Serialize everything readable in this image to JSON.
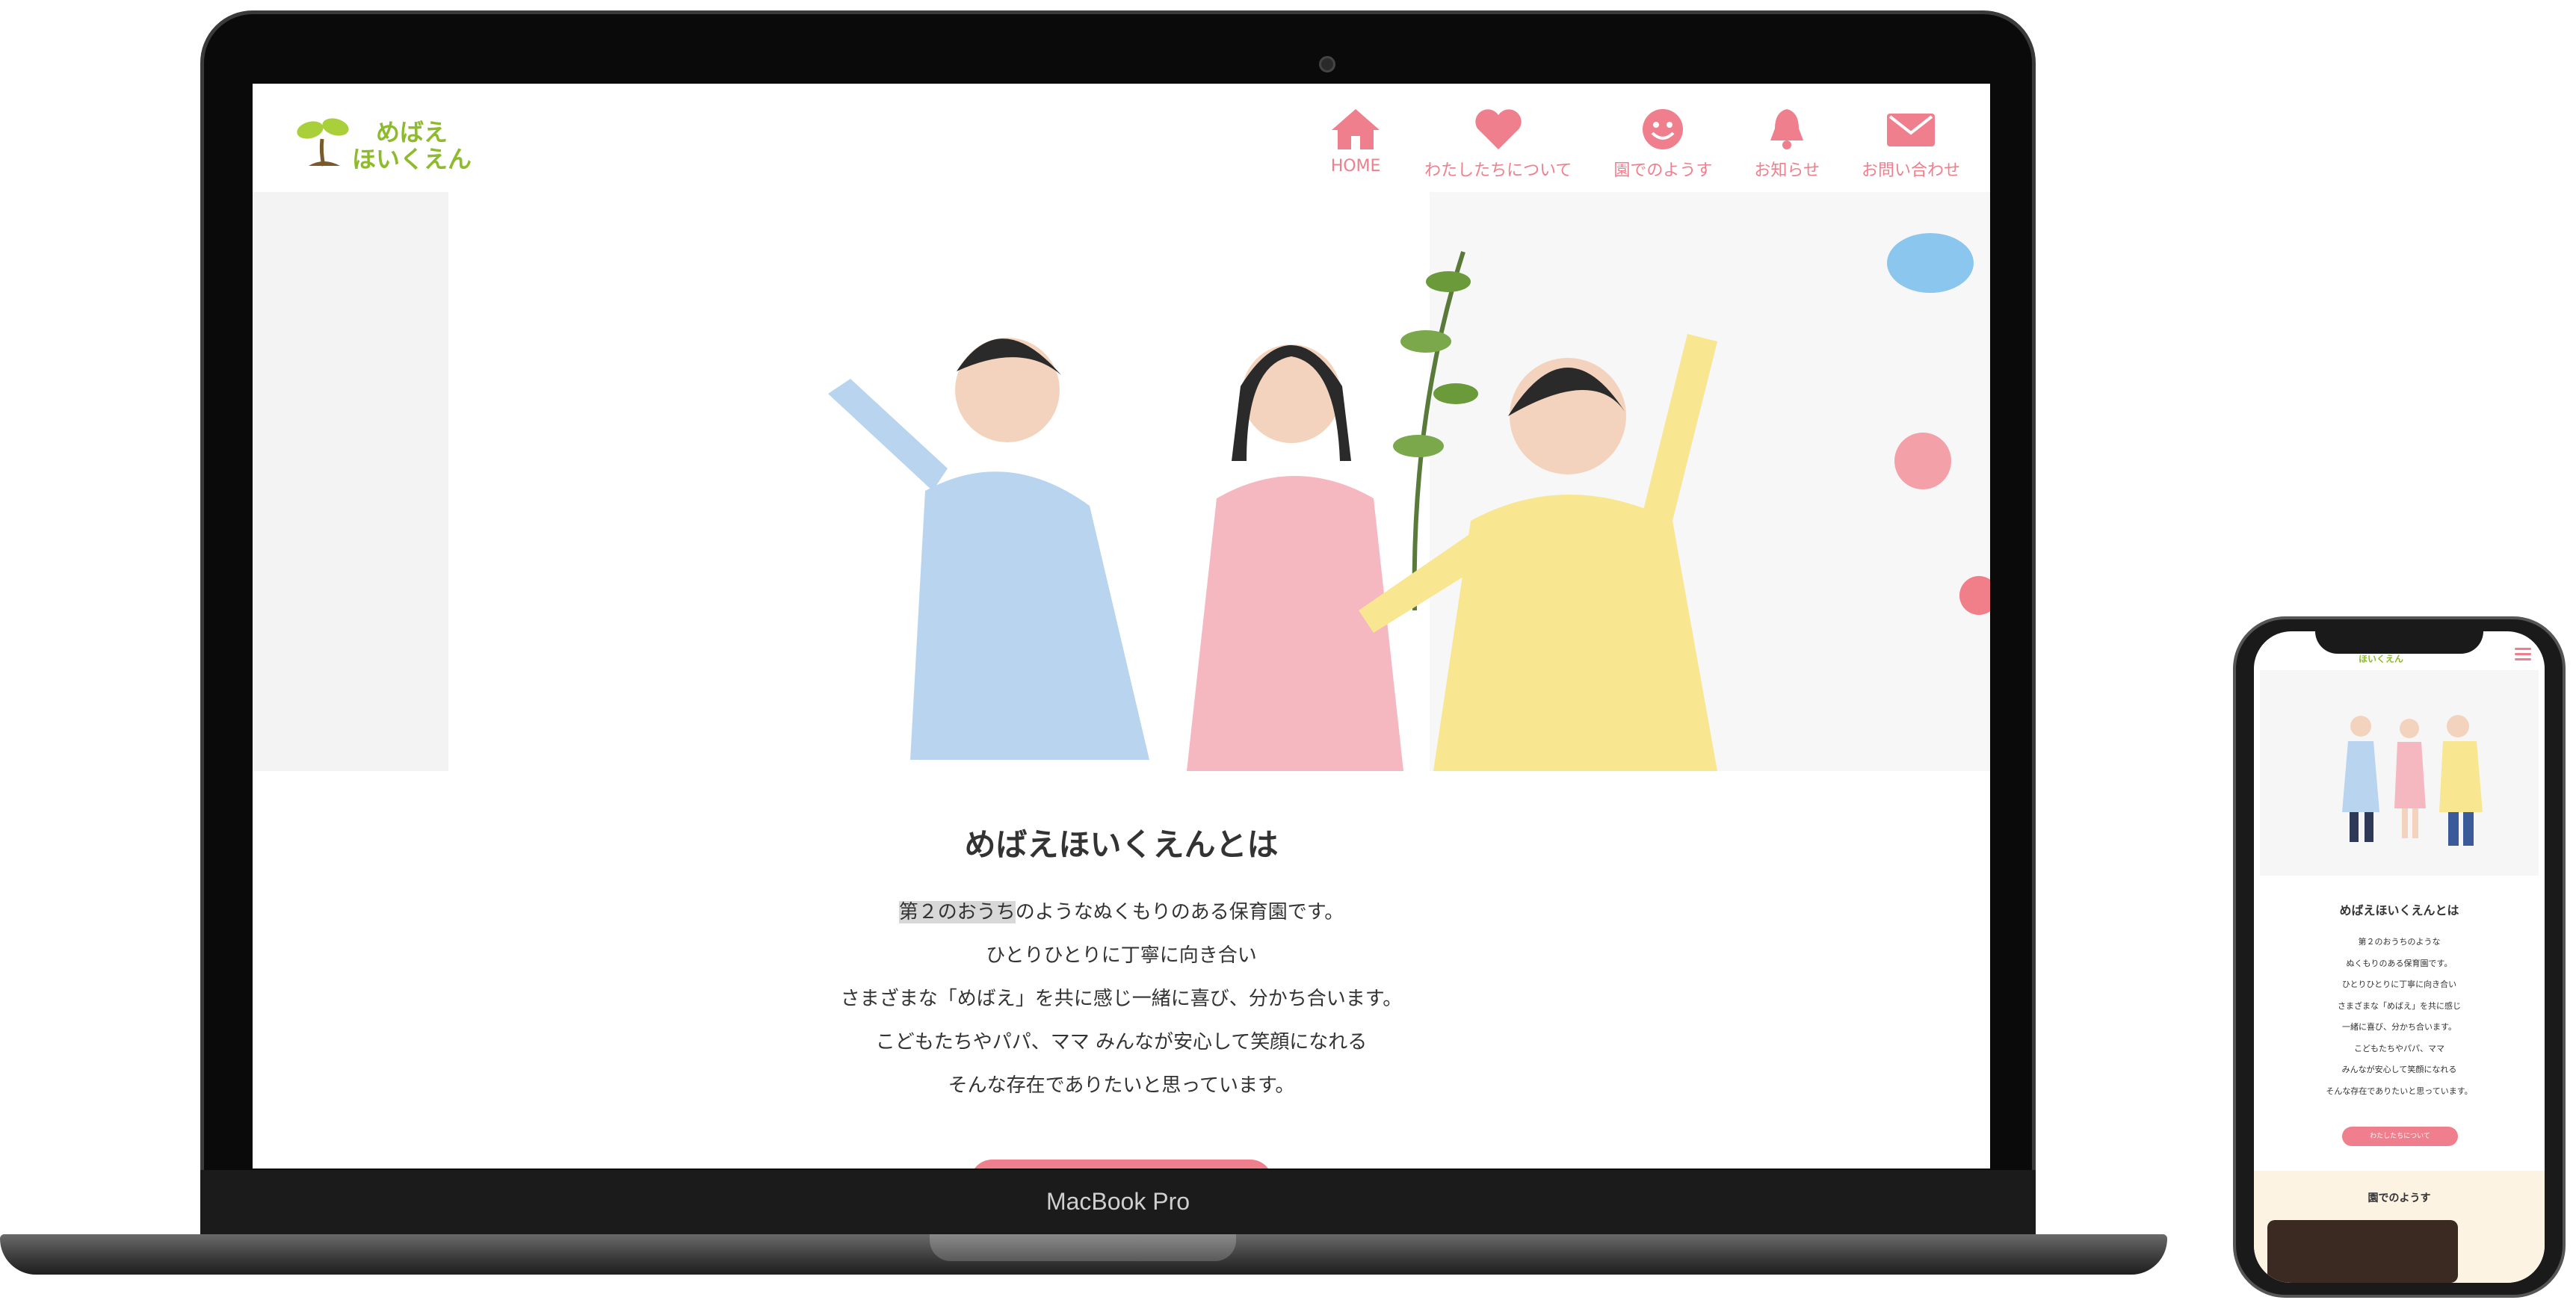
{
  "laptop": {
    "label": "MacBook Pro"
  },
  "site": {
    "logo": {
      "line1": "めばえ",
      "line2": "ほいくえん"
    },
    "nav": [
      {
        "label": "HOME",
        "icon": "home-icon"
      },
      {
        "label": "わたしたちについて",
        "icon": "heart-icon"
      },
      {
        "label": "園でのようす",
        "icon": "smile-icon"
      },
      {
        "label": "お知らせ",
        "icon": "bell-icon"
      },
      {
        "label": "お問い合わせ",
        "icon": "mail-icon"
      }
    ],
    "about": {
      "title": "めばえほいくえんとは",
      "line1_highlight": "第２のおうち",
      "line1_rest": "のようなぬくもりのある保育園です。",
      "line2": "ひとりひとりに丁寧に向き合い",
      "line3": "さまざまな「めばえ」を共に感じ一緒に喜び、分かち合います。",
      "line4": "こどもたちやパパ、ママ みんなが安心して笑顔になれる",
      "line5": "そんな存在でありたいと思っています。"
    },
    "accent": "#ef7f8d",
    "logo_color": "#8dbb2c"
  },
  "phone": {
    "logo": "ほいくえん",
    "about_title": "めばえほいくえんとは",
    "lines": [
      "第２のおうちのような",
      "ぬくもりのある保育園です。",
      "ひとりひとりに丁寧に向き合い",
      "さまざまな「めばえ」を共に感じ",
      "一緒に喜び、分かち合います。",
      "こどもたちやパパ、ママ",
      "みんなが安心して笑顔になれる",
      "そんな存在でありたいと思っています。"
    ],
    "button_label": "わたしたちについて",
    "section_title": "園でのようす"
  }
}
